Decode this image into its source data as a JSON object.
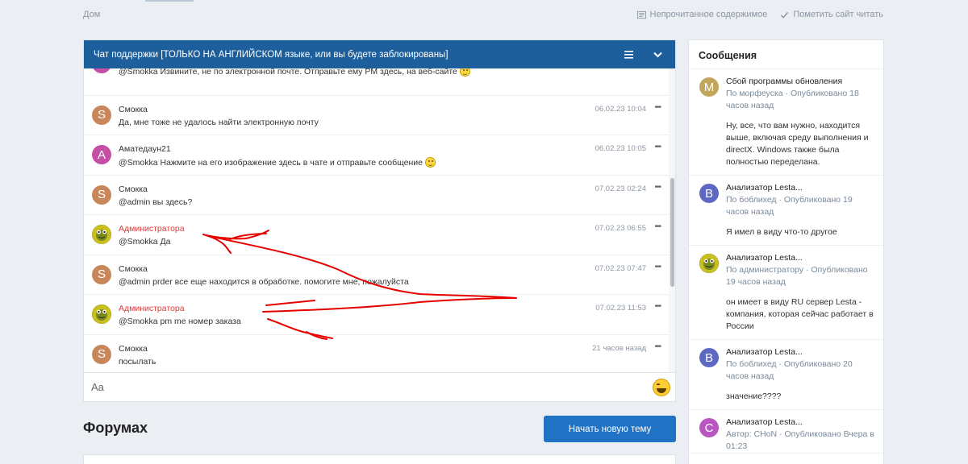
{
  "topbar": {
    "breadcrumb": "Дом",
    "unread_label": "Непрочитанное содержимое",
    "mark_read_label": "Пометить сайт читать"
  },
  "chat": {
    "title": "Чат поддержки [ТОЛЬКО НА АНГЛИЙСКОМ языке, или вы будете заблокированы]",
    "input_placeholder": "Aa",
    "messages": [
      {
        "name": "",
        "text": "@Smokka Извините, не по электронной почте. Отправьте ему PM здесь, на веб-сайте",
        "time": "",
        "initial": ""
      },
      {
        "name": "Смокка",
        "text": "Да, мне тоже не удалось найти электронную почту",
        "time": "06.02.23 10:04",
        "initial": "S"
      },
      {
        "name": "Аматедаун21",
        "text": "@Smokka Нажмите на его изображение здесь в чате и отправьте сообщение",
        "time": "06.02.23 10:05",
        "initial": "A"
      },
      {
        "name": "Смокка",
        "text": "@admin вы здесь?",
        "time": "07.02.23 02:24",
        "initial": "S"
      },
      {
        "name": "Администратора",
        "text": "@Smokka Да",
        "time": "07.02.23 06:55",
        "initial": ""
      },
      {
        "name": "Смокка",
        "text": "@admin prder все еще находится в обработке. помогите мне, пожалуйста",
        "time": "07.02.23 07:47",
        "initial": "S"
      },
      {
        "name": "Администратора",
        "text": "@Smokka pm me номер заказа",
        "time": "07.02.23 11:53",
        "initial": ""
      },
      {
        "name": "Смокка",
        "text": "посылать",
        "time": "21 часов назад",
        "initial": "S"
      }
    ]
  },
  "forums": {
    "title": "Форумах",
    "new_topic_label": "Начать новую тему"
  },
  "sidebar": {
    "title": "Сообщения",
    "posts": [
      {
        "initial": "M",
        "title": "Сбой программы обновления",
        "meta": "По морфеуска · Опубликовано 18 часов назад",
        "snippet": "Ну, все, что вам нужно, находится выше, включая среду выполнения и directX. Windows также была полностью переделана."
      },
      {
        "initial": "B",
        "title": "Анализатор Lesta...",
        "meta": "По боблихед · Опубликовано 19 часов назад",
        "snippet": "Я имел в виду что-то другое"
      },
      {
        "initial": "",
        "title": "Анализатор Lesta...",
        "meta": "По администратору · Опубликовано 19 часов назад",
        "snippet": "он имеет в виду RU сервер Lesta - компания, которая сейчас работает в России"
      },
      {
        "initial": "B",
        "title": "Анализатор Lesta...",
        "meta": "По боблихед · Опубликовано 20 часов назад",
        "snippet": "значение????"
      },
      {
        "initial": "C",
        "title": "Анализатор Lesta...",
        "meta": "Автор: CHoN · Опубликовано Вчера в 01:23",
        "snippet": ""
      }
    ]
  },
  "colors": {
    "header_blue": "#1d5f9c",
    "button_blue": "#1f72c4",
    "admin_red": "#e03a3a",
    "scribble_red": "#e60000",
    "avatar_s": "#c8875a",
    "avatar_a": "#c44fa3",
    "avatar_m": "#c2a65c",
    "avatar_b": "#5c69c2",
    "avatar_c": "#b857c2"
  }
}
